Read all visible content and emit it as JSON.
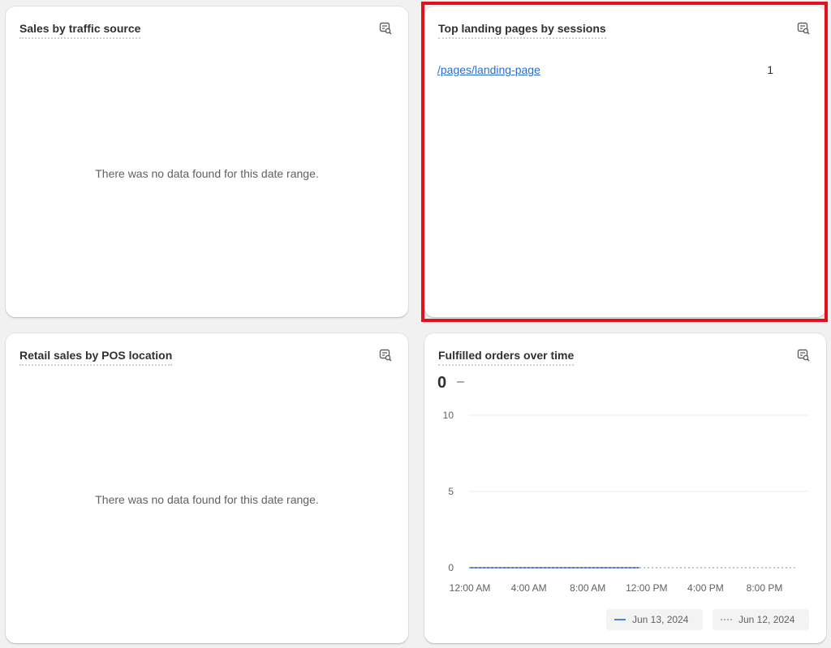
{
  "cards": {
    "traffic_source": {
      "title": "Sales by traffic source",
      "empty_message": "There was no data found for this date range.",
      "icon": "explore-data-icon"
    },
    "landing_pages": {
      "title": "Top landing pages by sessions",
      "icon": "explore-data-icon",
      "rows": [
        {
          "page": "/pages/landing-page",
          "sessions": "1"
        }
      ]
    },
    "pos_location": {
      "title": "Retail sales by POS location",
      "empty_message": "There was no data found for this date range.",
      "icon": "explore-data-icon"
    },
    "fulfilled_orders": {
      "title": "Fulfilled orders over time",
      "icon": "explore-data-icon",
      "total": "0",
      "change": "–"
    }
  },
  "colors": {
    "highlight": "#e0121b",
    "link": "#2c6ecb",
    "series_current": "#4b82d6",
    "series_previous": "#a9b4c2"
  },
  "chart_data": {
    "type": "line",
    "x": [
      "12:00 AM",
      "4:00 AM",
      "8:00 AM",
      "12:00 PM",
      "4:00 PM",
      "8:00 PM"
    ],
    "ylim": [
      0,
      10
    ],
    "yticks": [
      0,
      5,
      10
    ],
    "grid": true,
    "legend_position": "bottom-right",
    "series": [
      {
        "name": "Jun 13, 2024",
        "style": "solid",
        "x": [
          0,
          1,
          2,
          3,
          4,
          5,
          6,
          7,
          8,
          9,
          10,
          11,
          12
        ],
        "values": [
          0,
          0,
          0,
          0,
          0,
          0,
          0,
          0,
          0,
          0,
          0,
          0,
          0
        ]
      },
      {
        "name": "Jun 12, 2024",
        "style": "dotted",
        "x": [
          0,
          1,
          2,
          3,
          4,
          5,
          6,
          7,
          8,
          9,
          10,
          11,
          12,
          13,
          14,
          15,
          16,
          17,
          18,
          19,
          20,
          21,
          22,
          23
        ],
        "values": [
          0,
          0,
          0,
          0,
          0,
          0,
          0,
          0,
          0,
          0,
          0,
          0,
          0,
          0,
          0,
          0,
          0,
          0,
          0,
          0,
          0,
          0,
          0,
          0
        ]
      }
    ]
  }
}
